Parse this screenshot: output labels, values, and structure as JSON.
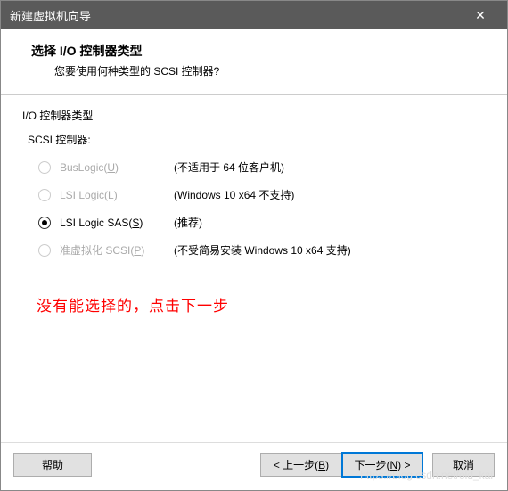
{
  "titlebar": {
    "title": "新建虚拟机向导",
    "close": "✕"
  },
  "header": {
    "title": "选择 I/O 控制器类型",
    "subtitle": "您要使用何种类型的 SCSI 控制器?"
  },
  "group": {
    "label": "I/O 控制器类型",
    "scsi_label": "SCSI 控制器:"
  },
  "options": {
    "buslogic": {
      "text": "BusLogic(",
      "key": "U",
      "end": ")",
      "note": "(不适用于 64 位客户机)"
    },
    "lsilogic": {
      "text": "LSI Logic(",
      "key": "L",
      "end": ")",
      "note": "(Windows 10 x64 不支持)"
    },
    "lsisas": {
      "text": "LSI Logic SAS(",
      "key": "S",
      "end": ")",
      "note": "(推荐)"
    },
    "paravirt": {
      "text": "准虚拟化 SCSI(",
      "key": "P",
      "end": ")",
      "note": "(不受简易安装 Windows 10 x64 支持)"
    }
  },
  "annotation": "没有能选择的，点击下一步",
  "footer": {
    "help": "帮助",
    "back_pre": "< 上一步(",
    "back_key": "B",
    "back_end": ")",
    "next_pre": "下一步(",
    "next_key": "N",
    "next_end": ") >",
    "cancel": "取消"
  },
  "watermark": "https://blog.csdn.net/old_kai"
}
